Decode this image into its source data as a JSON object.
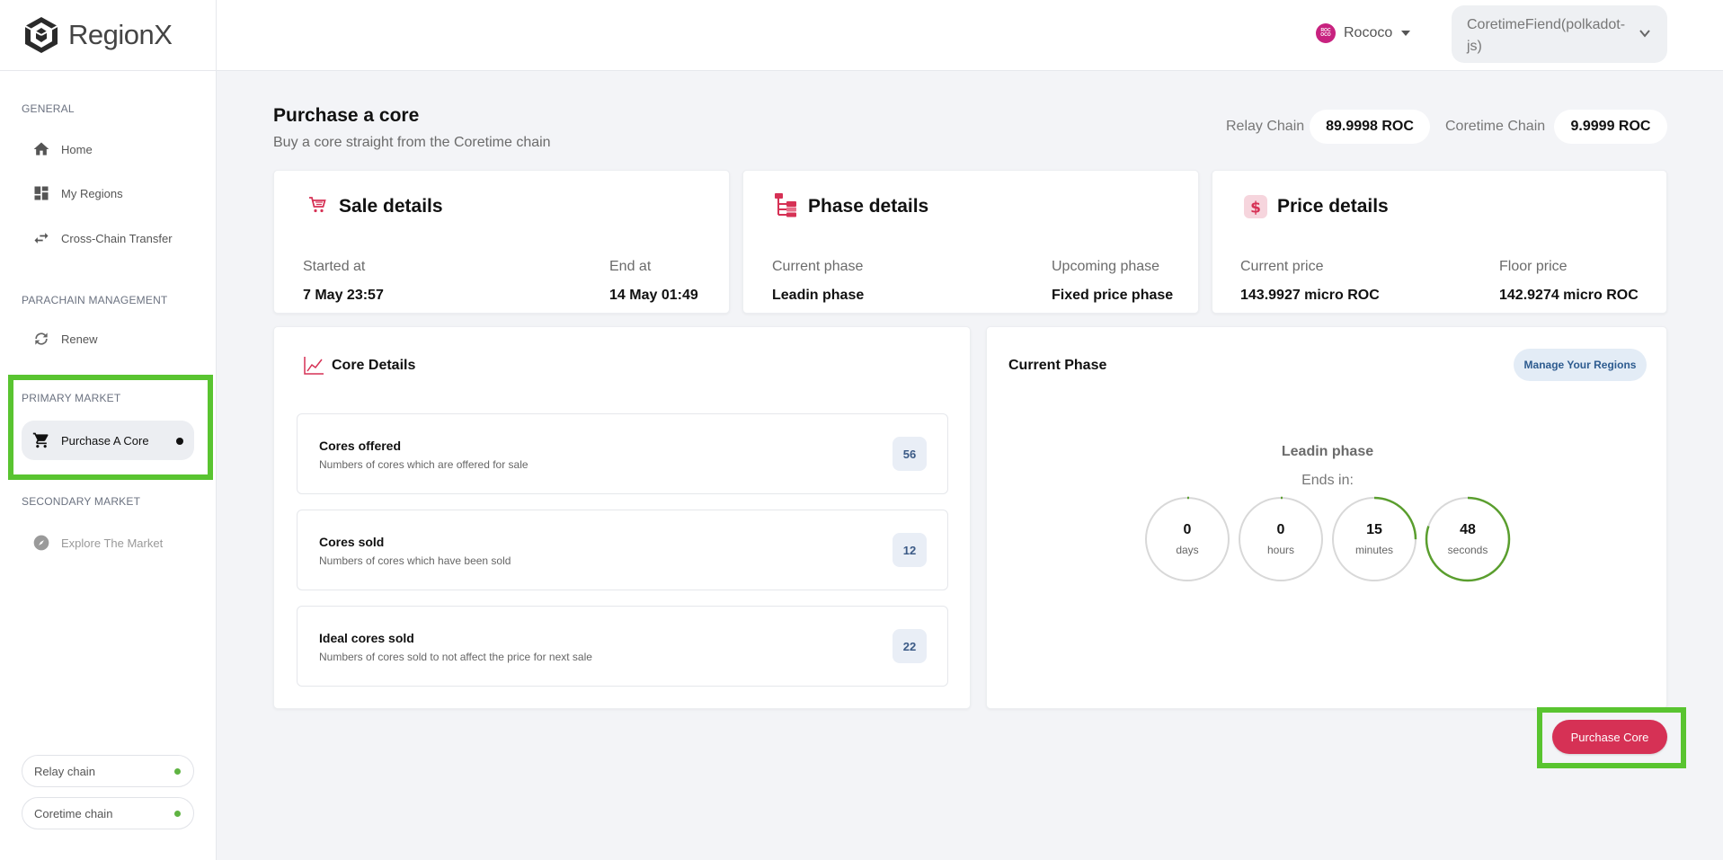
{
  "app": {
    "name": "RegionX"
  },
  "sidebar": {
    "general_title": "GENERAL",
    "general_items": [
      {
        "label": "Home",
        "icon": "home-icon"
      },
      {
        "label": "My Regions",
        "icon": "dashboard-icon"
      },
      {
        "label": "Cross-Chain Transfer",
        "icon": "transfer-arrows-icon"
      }
    ],
    "parachain_title": "PARACHAIN MANAGEMENT",
    "parachain_items": [
      {
        "label": "Renew",
        "icon": "renew-icon"
      }
    ],
    "primary_title": "PRIMARY MARKET",
    "primary_items": [
      {
        "label": "Purchase A Core",
        "icon": "cart-icon",
        "active": true
      }
    ],
    "secondary_title": "SECONDARY MARKET",
    "secondary_items": [
      {
        "label": "Explore The Market",
        "icon": "compass-icon",
        "disabled": true
      }
    ],
    "chains": [
      {
        "label": "Relay chain",
        "status_color": "#5fb342"
      },
      {
        "label": "Coretime chain",
        "status_color": "#5fb342"
      }
    ]
  },
  "header": {
    "network": {
      "name": "Rococo",
      "logo_text": "ROC OCO"
    },
    "account": {
      "name": "CoretimeFiend(polkadot-js)"
    }
  },
  "page": {
    "title": "Purchase a core",
    "subtitle": "Buy a core straight from the Coretime chain",
    "balances": [
      {
        "label": "Relay Chain",
        "value": "89.9998 ROC"
      },
      {
        "label": "Coretime Chain",
        "value": "9.9999 ROC"
      }
    ]
  },
  "sale_details": {
    "title": "Sale details",
    "started_label": "Started at",
    "started_value": "7 May 23:57",
    "end_label": "End at",
    "end_value": "14 May 01:49"
  },
  "phase_details": {
    "title": "Phase details",
    "current_label": "Current phase",
    "current_value": "Leadin phase",
    "upcoming_label": "Upcoming phase",
    "upcoming_value": "Fixed price phase"
  },
  "price_details": {
    "title": "Price details",
    "current_label": "Current price",
    "current_value": "143.9927 micro ROC",
    "floor_label": "Floor price",
    "floor_value": "142.9274 micro ROC"
  },
  "core_details": {
    "title": "Core Details",
    "rows": [
      {
        "title": "Cores offered",
        "subtitle": "Numbers of cores which are offered for sale",
        "value": "56"
      },
      {
        "title": "Cores sold",
        "subtitle": "Numbers of cores which have been sold",
        "value": "12"
      },
      {
        "title": "Ideal cores sold",
        "subtitle": "Numbers of cores sold to not affect the price for next sale",
        "value": "22"
      }
    ]
  },
  "current_phase": {
    "title": "Current Phase",
    "manage_button": "Manage Your Regions",
    "phase_name": "Leadin phase",
    "ends_in": "Ends in:",
    "countdown": [
      {
        "value": "0",
        "unit": "days",
        "progress": 0.0
      },
      {
        "value": "0",
        "unit": "hours",
        "progress": 0.0
      },
      {
        "value": "15",
        "unit": "minutes",
        "progress": 0.25
      },
      {
        "value": "48",
        "unit": "seconds",
        "progress": 0.8
      }
    ],
    "ring_color": "#5a9e2e",
    "track_color": "#d8d8d8"
  },
  "actions": {
    "purchase_button": "Purchase Core"
  },
  "colors": {
    "accent": "#d63155",
    "highlight": "#59c430"
  }
}
